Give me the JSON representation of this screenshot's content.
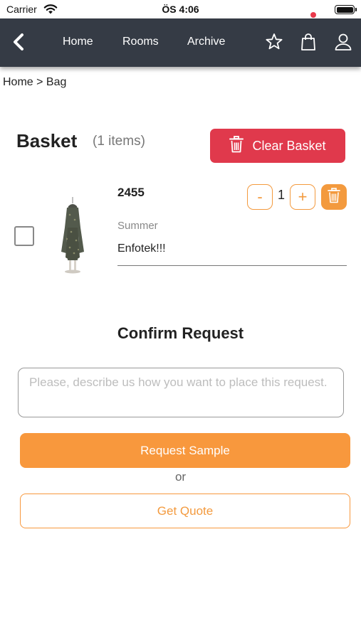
{
  "status_bar": {
    "carrier": "Carrier",
    "time": "ÖS 4:06"
  },
  "nav": {
    "home": "Home",
    "rooms": "Rooms",
    "archive": "Archive",
    "icons": [
      "back-chevron",
      "star",
      "shopping-bag",
      "user"
    ],
    "bag_badge_color": "#e8394b"
  },
  "breadcrumb": "Home > Bag",
  "basket": {
    "title": "Basket",
    "count": "(1 items)",
    "clear_label": "Clear Basket"
  },
  "items": [
    {
      "code": "2455",
      "season": "Summer",
      "quantity": "1",
      "note": "Enfotek!!!",
      "minus_label": "-",
      "plus_label": "+",
      "checked": false
    }
  ],
  "confirm": {
    "title": "Confirm Request",
    "placeholder": "Please, describe us how you want to place this request.",
    "request_sample_label": "Request Sample",
    "or_label": "or",
    "get_quote_label": "Get Quote"
  },
  "colors": {
    "nav_bg": "#353b45",
    "danger": "#e0394c",
    "accent": "#f8983d"
  }
}
